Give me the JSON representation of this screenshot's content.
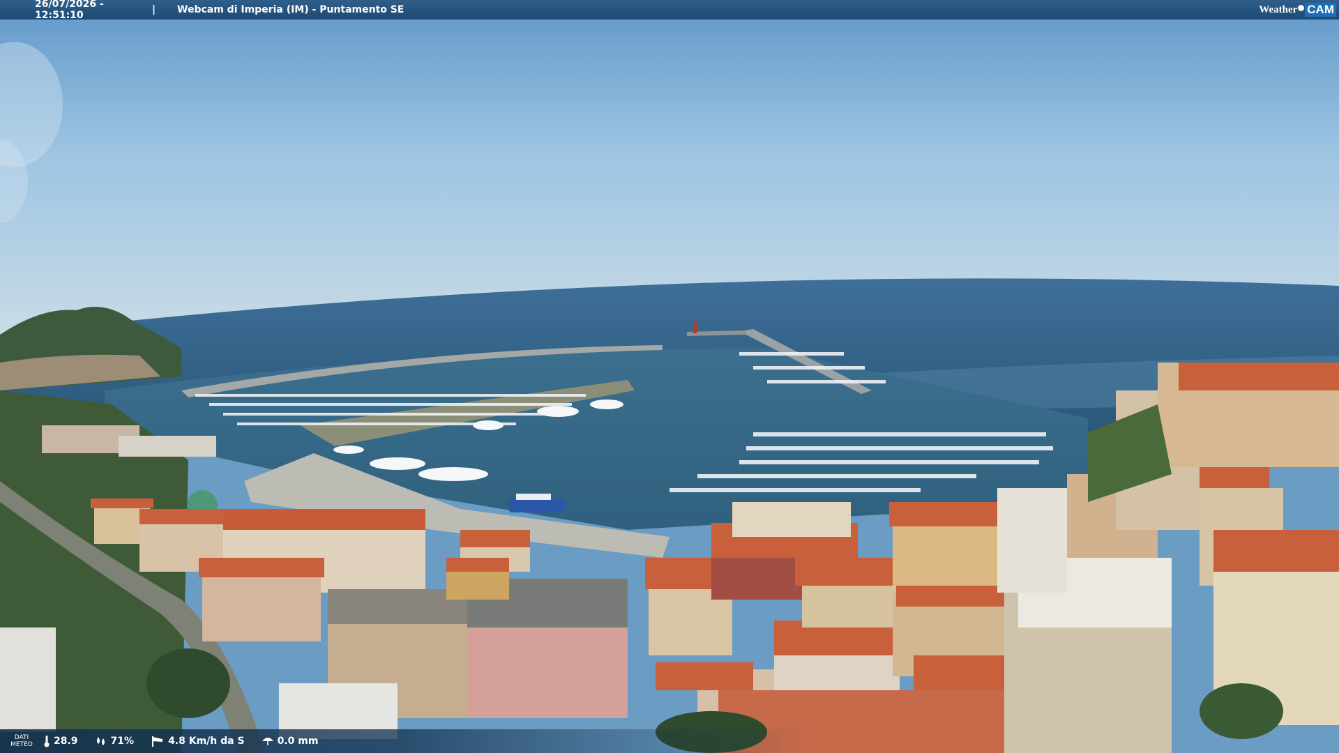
{
  "header": {
    "timestamp": "26/07/2026 - 12:51:10",
    "separator": "|",
    "title": "Webcam di Imperia (IM) - Puntamento SE",
    "brand_weather": "Weather",
    "brand_cam": "CAM"
  },
  "meteo": {
    "label_line1": "DATI",
    "label_line2": "METEO",
    "temperature": "28.9",
    "humidity": "71%",
    "wind": "4.8 Km/h da S",
    "rain": "0.0 mm"
  },
  "icons": {
    "temperature": "thermometer-icon",
    "humidity": "humidity-drops-icon",
    "wind": "wind-sock-icon",
    "rain": "umbrella-icon"
  },
  "colors": {
    "bar": "#1e4a73",
    "sky_top": "#6a9fd0",
    "sea": "#2f5f85",
    "roof": "#c8603c"
  }
}
